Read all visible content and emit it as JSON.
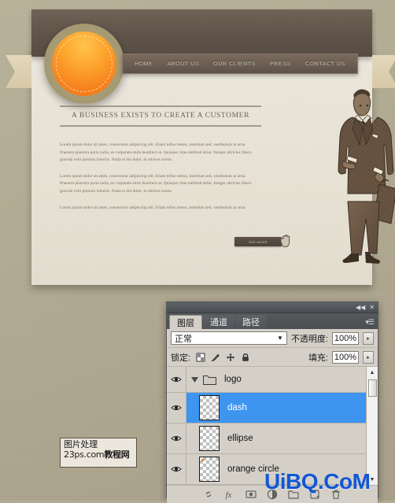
{
  "mockup": {
    "nav": [
      {
        "label": "HOME"
      },
      {
        "label": "ABOUT US"
      },
      {
        "label": "OUR CLIENTS"
      },
      {
        "label": "PRESS"
      },
      {
        "label": "CONTACT US"
      }
    ],
    "headline": "A BUSINESS EXISTS TO CREATE A CUSTOMER",
    "paragraphs": [
      "Lorem ipsum dolor sit amet, consectetur adipiscing elit. Etiam tellus metus, interdum sed, vestibulum at urna. Praesent pharetra porta nulla, eu vulputate enim hendrerit at. Quisque vitae eleifend dolor. Integer ultricies libero gravida velit pretium lobortis. Nulla et dui dolor, in ultrices lorem.",
      "Lorem ipsum dolor sit amet, consectetur adipiscing elit. Etiam tellus metus, interdum sed, vestibulum at urna. Praesent pharetra porta nulla, eu vulputate enim hendrerit at. Quisque vitae eleifend dolor. Integer ultricies libero gravida velit pretium lobortis. Nulla et dui dolor, in ultrices lorem.",
      "Lorem ipsum dolor sit amet, consectetur adipiscing elit. Etiam tellus metus, interdum sed, vestibulum at urna."
    ],
    "cta_label": "SEE MORE",
    "colors": {
      "header_bar": "#60544a",
      "logo_orange": "#f6821f",
      "logo_ring": "#a79b74",
      "page_bg": "#ece7dc",
      "ribbon_tail": "#e4d8bb"
    }
  },
  "panel": {
    "tabs": [
      {
        "label": "图层",
        "active": true
      },
      {
        "label": "通道",
        "active": false
      },
      {
        "label": "路径",
        "active": false
      }
    ],
    "blend_mode": "正常",
    "opacity_label": "不透明度:",
    "opacity_value": "100%",
    "lock_label": "锁定:",
    "fill_label": "填充:",
    "fill_value": "100%",
    "lock_icons": [
      "lock-transparent-pixels-icon",
      "lock-image-pixels-icon",
      "lock-position-icon",
      "lock-all-icon"
    ],
    "layers": [
      {
        "name": "logo",
        "type": "group",
        "selected": false,
        "expanded": true,
        "visible": true
      },
      {
        "name": "dash",
        "type": "layer",
        "selected": true,
        "visible": true
      },
      {
        "name": "ellipse",
        "type": "layer",
        "selected": false,
        "visible": true
      },
      {
        "name": "orange circle",
        "type": "layer",
        "selected": false,
        "visible": true
      }
    ],
    "footer_buttons": [
      "link-layers-icon",
      "add-layer-style-icon",
      "add-layer-mask-icon",
      "new-adjustment-layer-icon",
      "new-group-icon",
      "new-layer-icon",
      "delete-layer-icon"
    ],
    "titlebar_buttons": [
      "collapse-icon",
      "close-icon"
    ],
    "selection_color": "#3d95f0"
  },
  "watermarks": {
    "box_line1": "图片处理",
    "box_line2_en": "23ps.com",
    "box_line2_cn": "教程网",
    "big": "UiBQ.CoM",
    "big_color": "#1257d6"
  }
}
